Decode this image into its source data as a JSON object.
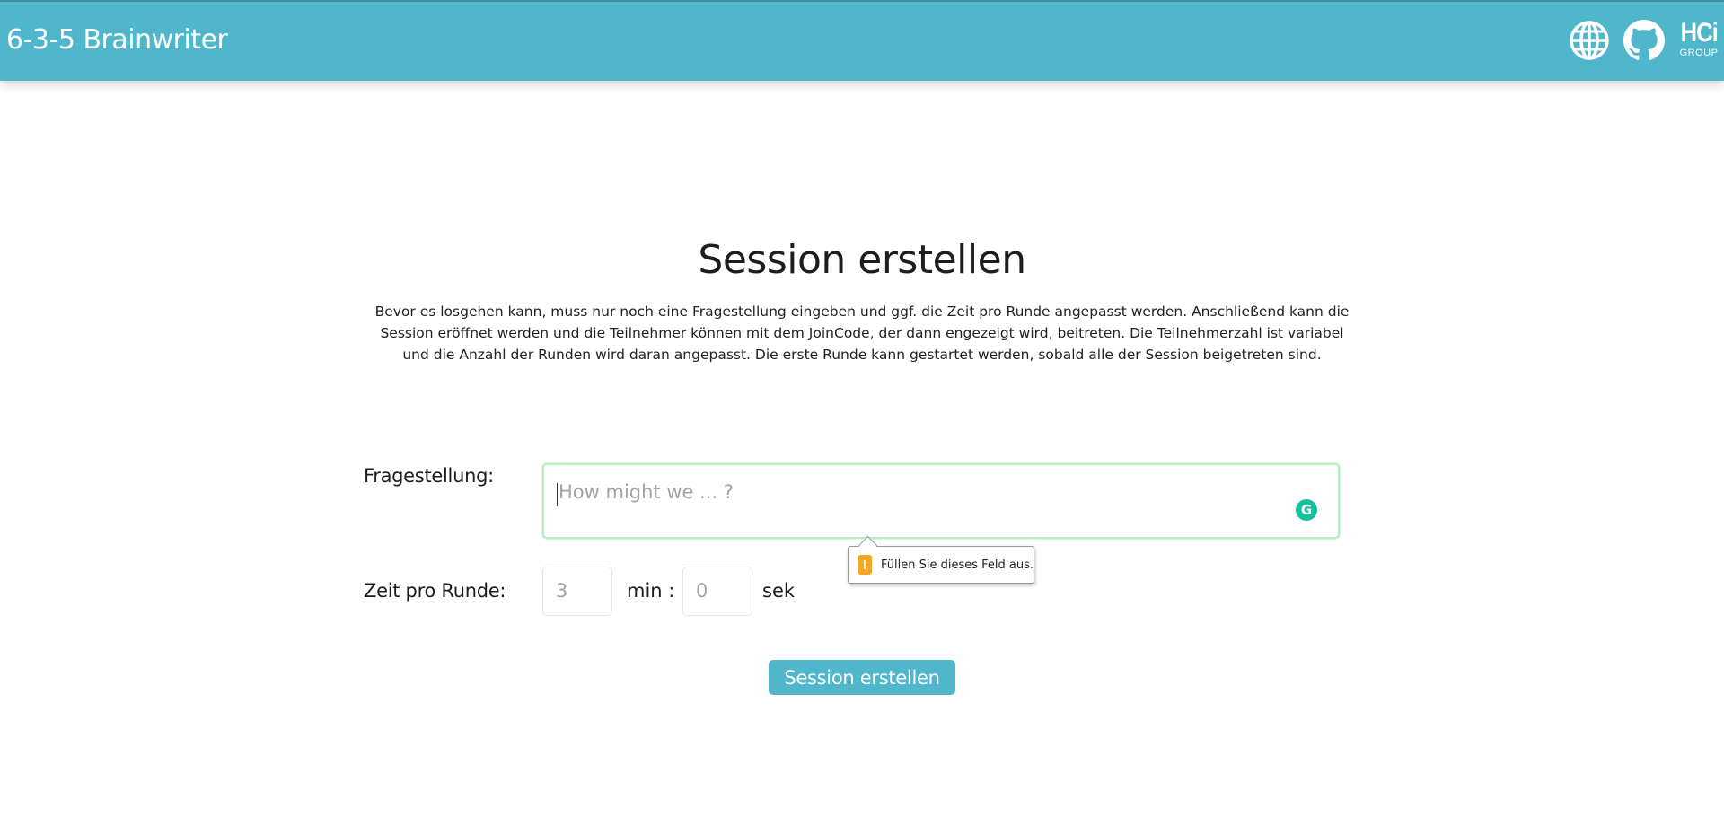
{
  "navbar": {
    "brand": "6-3-5 Brainwriter",
    "icons": [
      "globe-icon",
      "github-icon",
      "hci-group-logo"
    ],
    "logo_text": "HCi",
    "logo_subtext": "GROUP",
    "color": "#50b6cc"
  },
  "main": {
    "title": "Session erstellen",
    "intro": "Bevor es losgehen kann, muss nur noch eine Fragestellung eingeben und ggf. die Zeit pro Runde angepasst werden. Anschließend kann die Session eröffnet werden und die Teilnehmer können mit dem JoinCode, der dann engezeigt wird, beitreten. Die Teilnehmerzahl ist variabel und die Anzahl der Runden wird daran angepasst. Die erste Runde kann gestartet werden, sobald alle der Session beigetreten sind."
  },
  "form": {
    "question_label": "Fragestellung:",
    "question_placeholder": "How might we ... ?",
    "question_value": "",
    "validation_message": "Füllen Sie dieses Feld aus.",
    "time_label": "Zeit pro Runde:",
    "minutes_placeholder": "3",
    "minutes_unit": "min :",
    "seconds_placeholder": "0",
    "seconds_unit": "sek",
    "submit_label": "Session erstellen"
  },
  "colors": {
    "accent": "#50b6cc",
    "focus_border": "#b5f0c1",
    "grammarly": "#15c39a",
    "warning": "#f5a623"
  }
}
